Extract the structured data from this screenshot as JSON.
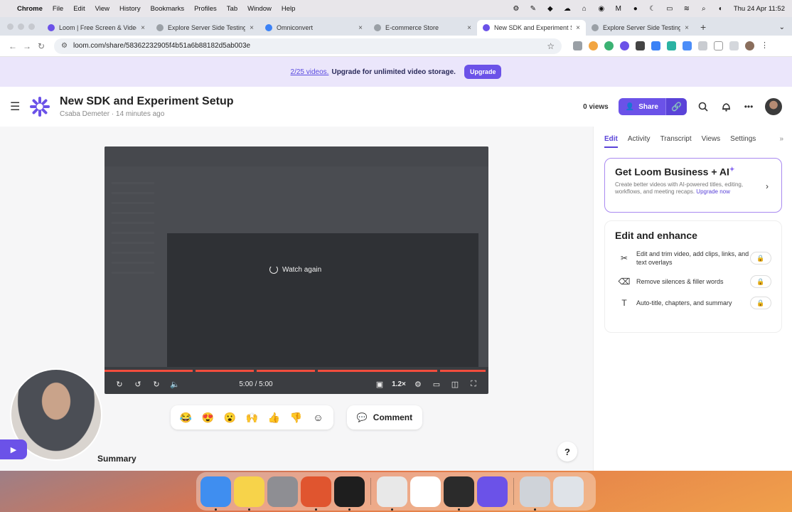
{
  "menubar": {
    "app": "Chrome",
    "items": [
      "File",
      "Edit",
      "View",
      "History",
      "Bookmarks",
      "Profiles",
      "Tab",
      "Window",
      "Help"
    ],
    "datetime": "Thu 24 Apr  11:52"
  },
  "tabs": [
    {
      "title": "Loom | Free Screen & Video R",
      "color": "#6b52e8",
      "active": false
    },
    {
      "title": "Explore Server Side Testing S",
      "color": "#9aa0a6",
      "active": false
    },
    {
      "title": "Omniconvert",
      "color": "#3b82f6",
      "active": false
    },
    {
      "title": "E-commerce Store",
      "color": "#9aa0a6",
      "active": false
    },
    {
      "title": "New SDK and Experiment Set",
      "color": "#6b52e8",
      "active": true
    },
    {
      "title": "Explore Server Side Testing S",
      "color": "#9aa0a6",
      "active": false
    }
  ],
  "address": {
    "url": "loom.com/share/58362232905f4b51a6b88182d5ab003e"
  },
  "banner": {
    "count": "2/25 videos.",
    "text": "Upgrade for unlimited video storage.",
    "button": "Upgrade"
  },
  "header": {
    "title": "New SDK and Experiment Setup",
    "author": "Csaba Demeter",
    "time": "14 minutes ago",
    "views": "0 views",
    "share": "Share"
  },
  "player": {
    "watch_again": "Watch again",
    "time": "5:00 / 5:00",
    "speed": "1.2×",
    "progress_fraction": 1.0,
    "accent": "#f24d3d"
  },
  "reactions": [
    "😂",
    "😍",
    "😮",
    "🙌",
    "👍",
    "👎"
  ],
  "comment": "Comment",
  "summary": "Summary",
  "help": "?",
  "side": {
    "tabs": [
      "Edit",
      "Activity",
      "Transcript",
      "Views",
      "Settings"
    ],
    "ai_card": {
      "title": "Get Loom Business + AI",
      "desc": "Create better videos with AI-powered titles, editing, workflows, and meeting recaps.",
      "link": "Upgrade now"
    },
    "enhance": {
      "title": "Edit and enhance",
      "features": [
        {
          "icon": "scissors-icon",
          "glyph": "✂",
          "text": "Edit and trim video, add clips, links, and text overlays"
        },
        {
          "icon": "eraser-icon",
          "glyph": "⌫",
          "text": "Remove silences & filler words"
        },
        {
          "icon": "text-icon",
          "glyph": "T",
          "text": "Auto-title, chapters, and summary"
        }
      ]
    }
  },
  "dock": [
    {
      "name": "finder",
      "color": "#3f8ef0"
    },
    {
      "name": "notes",
      "color": "#f7d34a"
    },
    {
      "name": "system-settings",
      "color": "#8e8e93"
    },
    {
      "name": "firefox",
      "color": "#e0552f"
    },
    {
      "name": "terminal",
      "color": "#1e1e1e"
    },
    {
      "name": "chrome",
      "color": "#e8e8e8"
    },
    {
      "name": "slack",
      "color": "#ffffff"
    },
    {
      "name": "app",
      "color": "#2b2b2b"
    },
    {
      "name": "loom",
      "color": "#6b52e8"
    },
    {
      "name": "preview",
      "color": "#cfd3d9"
    },
    {
      "name": "trash",
      "color": "#dfe3e8"
    }
  ]
}
